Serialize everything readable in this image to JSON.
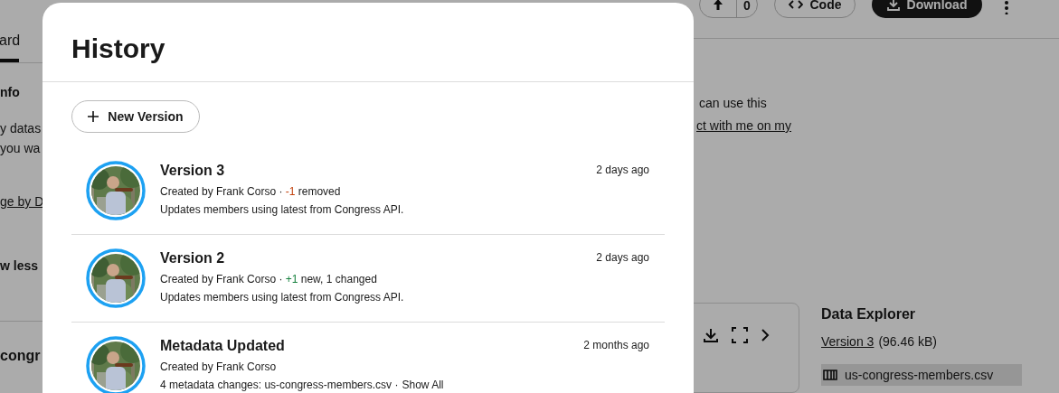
{
  "page": {
    "tab": "ard",
    "section_heading": "nfo",
    "description_lines": [
      "y datas",
      "you wa"
    ],
    "link": "ge by D",
    "toggle": "w less",
    "file_heading": "congr",
    "upvote_count": "0",
    "code_button": "Code",
    "download_button": "Download",
    "description_right": "can use this",
    "link_right": "ct with me on my",
    "data_explorer": {
      "title": "Data Explorer",
      "version_link": "Version 3",
      "size": "(96.46 kB)",
      "file": "us-congress-members.csv"
    }
  },
  "history": {
    "title": "History",
    "new_version": "New Version",
    "entries": [
      {
        "title": "Version 3",
        "byline": "Created by Frank Corso",
        "separator": "·",
        "change": {
          "kind": "removed",
          "count": "-1",
          "text": "removed"
        },
        "description": "Updates members using latest from Congress API.",
        "time": "2 days ago"
      },
      {
        "title": "Version 2",
        "byline": "Created by Frank Corso",
        "separator": "·",
        "change": {
          "kind": "added",
          "count": "+1",
          "text": "new, 1 changed"
        },
        "description": "Updates members using latest from Congress API.",
        "time": "2 days ago"
      },
      {
        "title": "Metadata Updated",
        "byline": "Created by Frank Corso",
        "description": "4 metadata changes: us-congress-members.csv",
        "separator": "·",
        "link": "Show All",
        "time": "2 months ago"
      }
    ]
  }
}
